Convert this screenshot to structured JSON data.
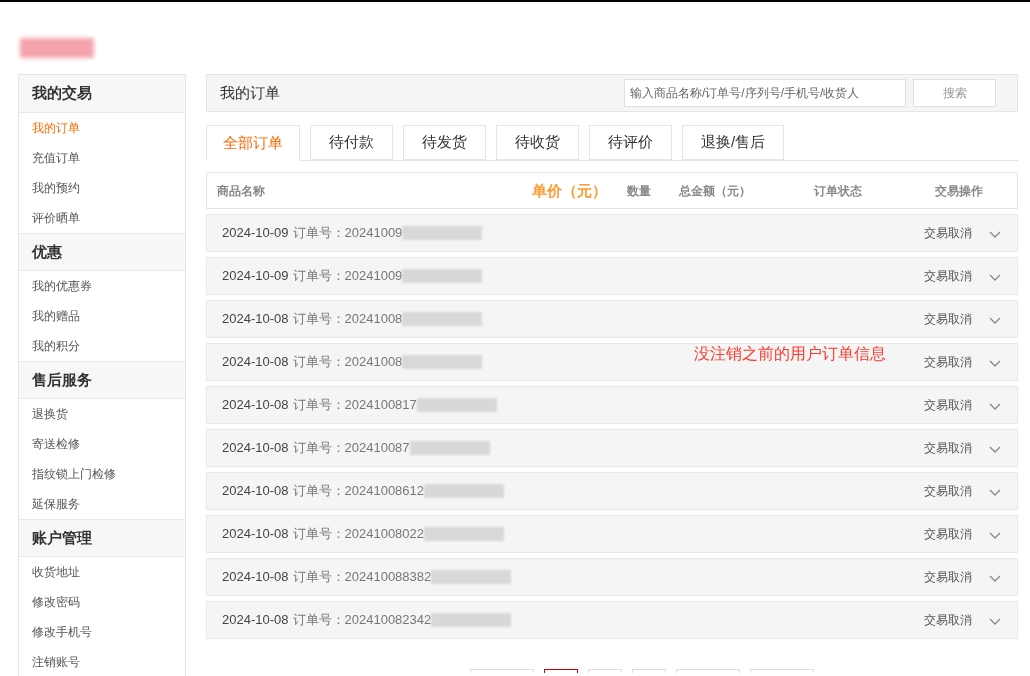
{
  "sidebar": {
    "groups": [
      {
        "title": "我的交易",
        "items": [
          {
            "label": "我的订单",
            "selected": true
          },
          {
            "label": "充值订单",
            "selected": false
          },
          {
            "label": "我的预约",
            "selected": false
          },
          {
            "label": "评价晒单",
            "selected": false
          }
        ]
      },
      {
        "title": "优惠",
        "items": [
          {
            "label": "我的优惠券",
            "selected": false
          },
          {
            "label": "我的赠品",
            "selected": false
          },
          {
            "label": "我的积分",
            "selected": false
          }
        ]
      },
      {
        "title": "售后服务",
        "items": [
          {
            "label": "退换货",
            "selected": false
          },
          {
            "label": "寄送检修",
            "selected": false
          },
          {
            "label": "指纹锁上门检修",
            "selected": false
          },
          {
            "label": "延保服务",
            "selected": false
          }
        ]
      },
      {
        "title": "账户管理",
        "items": [
          {
            "label": "收货地址",
            "selected": false
          },
          {
            "label": "修改密码",
            "selected": false
          },
          {
            "label": "修改手机号",
            "selected": false
          },
          {
            "label": "注销账号",
            "selected": false
          }
        ]
      }
    ]
  },
  "header": {
    "title": "我的订单",
    "search": {
      "placeholder": "输入商品名称/订单号/序列号/手机号/收货人"
    },
    "search_button": "搜索"
  },
  "tabs": [
    {
      "label": "全部订单",
      "selected": true
    },
    {
      "label": "待付款",
      "selected": false
    },
    {
      "label": "待发货",
      "selected": false
    },
    {
      "label": "待收货",
      "selected": false
    },
    {
      "label": "待评价",
      "selected": false
    },
    {
      "label": "退换/售后",
      "selected": false
    }
  ],
  "table": {
    "columns": [
      "商品名称",
      "单价（元）",
      "数量",
      "总金额（元）",
      "订单状态",
      "交易操作"
    ],
    "rows": [
      {
        "date": "2024-10-09",
        "order_label": "订单号：",
        "order_no": "20241009",
        "status": "交易取消"
      },
      {
        "date": "2024-10-09",
        "order_label": "订单号：",
        "order_no": "20241009",
        "status": "交易取消"
      },
      {
        "date": "2024-10-08",
        "order_label": "订单号：",
        "order_no": "20241008",
        "status": "交易取消"
      },
      {
        "date": "2024-10-08",
        "order_label": "订单号：",
        "order_no": "20241008",
        "status": "交易取消"
      },
      {
        "date": "2024-10-08",
        "order_label": "订单号：",
        "order_no": "2024100817",
        "status": "交易取消"
      },
      {
        "date": "2024-10-08",
        "order_label": "订单号：",
        "order_no": "202410087",
        "status": "交易取消"
      },
      {
        "date": "2024-10-08",
        "order_label": "订单号：",
        "order_no": "20241008612",
        "status": "交易取消"
      },
      {
        "date": "2024-10-08",
        "order_label": "订单号：",
        "order_no": "20241008022",
        "status": "交易取消"
      },
      {
        "date": "2024-10-08",
        "order_label": "订单号：",
        "order_no": "202410088382",
        "status": "交易取消"
      },
      {
        "date": "2024-10-08",
        "order_label": "订单号：",
        "order_no": "202410082342",
        "status": "交易取消"
      }
    ]
  },
  "annotation": "没注销之前的用户订单信息"
}
